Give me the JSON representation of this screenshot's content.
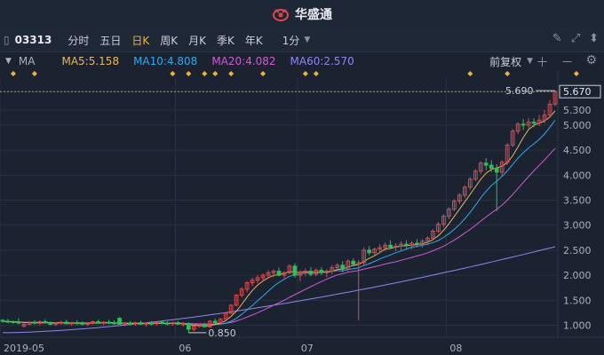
{
  "header": {
    "brand": "华盛通"
  },
  "toolbar": {
    "ticker": "03313",
    "periods": [
      "分时",
      "五日",
      "日K",
      "周K",
      "月K",
      "季K",
      "年K"
    ],
    "active_period": "日K",
    "minute_select": "1分"
  },
  "ma_bar": {
    "label": "MA",
    "ma5": "MA5:5.158",
    "ma10": "MA10:4.808",
    "ma20": "MA20:4.082",
    "ma60": "MA60:2.570",
    "fq": "前复权"
  },
  "colors": {
    "up": "#e0474c",
    "down": "#2fbf5a",
    "ma5": "#e8b65a",
    "ma10": "#34a6e8",
    "ma20": "#d35ad3",
    "ma60": "#8f86f0",
    "bg": "#1b2331",
    "grid": "#283243",
    "accent": "#f0b23a"
  },
  "chart_data": {
    "type": "candlestick",
    "ylim": [
      0.76,
      5.94
    ],
    "y_ticks": [
      "1.000",
      "1.500",
      "2.000",
      "2.500",
      "3.000",
      "3.500",
      "4.000",
      "4.500",
      "5.000",
      "5.300",
      "5.670"
    ],
    "x_ticks": [
      {
        "label": "2019-05",
        "index": 0
      },
      {
        "label": "06",
        "index": 33
      },
      {
        "label": "07",
        "index": 56
      },
      {
        "label": "08",
        "index": 84
      }
    ],
    "annotations": {
      "high_label": "5.690",
      "low_label": "0.850",
      "last_price": "5.670"
    },
    "event_markers": [
      2,
      6,
      32,
      35,
      38,
      40,
      43,
      49,
      57,
      59,
      88,
      95,
      108
    ],
    "candles": [
      [
        1.1,
        1.12,
        1.05,
        1.08
      ],
      [
        1.08,
        1.13,
        1.04,
        1.07
      ],
      [
        1.07,
        1.1,
        1.03,
        1.06
      ],
      [
        1.06,
        1.14,
        1.02,
        1.05
      ],
      [
        0.98,
        1.04,
        0.96,
        1.02
      ],
      [
        1.02,
        1.08,
        1.0,
        1.06
      ],
      [
        1.06,
        1.1,
        1.02,
        1.04
      ],
      [
        1.04,
        1.09,
        1.0,
        1.07
      ],
      [
        1.07,
        1.12,
        1.03,
        1.05
      ],
      [
        1.05,
        1.08,
        1.0,
        1.02
      ],
      [
        1.02,
        1.06,
        0.98,
        1.04
      ],
      [
        1.04,
        1.09,
        1.01,
        1.06
      ],
      [
        1.06,
        1.11,
        1.02,
        1.03
      ],
      [
        1.03,
        1.07,
        0.99,
        1.05
      ],
      [
        1.05,
        1.1,
        1.01,
        1.04
      ],
      [
        1.04,
        1.08,
        1.0,
        1.02
      ],
      [
        1.02,
        1.06,
        0.98,
        1.05
      ],
      [
        1.05,
        1.09,
        1.01,
        1.07
      ],
      [
        1.07,
        1.11,
        1.03,
        1.04
      ],
      [
        1.04,
        1.08,
        1.0,
        1.06
      ],
      [
        1.06,
        1.11,
        1.02,
        1.05
      ],
      [
        1.05,
        1.1,
        1.01,
        1.03
      ],
      [
        1.14,
        1.16,
        1.01,
        1.02
      ],
      [
        1.02,
        1.06,
        0.98,
        1.04
      ],
      [
        1.04,
        1.08,
        1.0,
        1.03
      ],
      [
        1.03,
        1.07,
        0.99,
        1.05
      ],
      [
        1.05,
        1.09,
        1.01,
        1.02
      ],
      [
        1.02,
        1.06,
        0.97,
        1.04
      ],
      [
        1.04,
        1.08,
        1.0,
        1.03
      ],
      [
        1.03,
        1.07,
        0.99,
        1.06
      ],
      [
        1.06,
        1.1,
        1.02,
        1.04
      ],
      [
        1.04,
        1.08,
        1.0,
        1.03
      ],
      [
        1.03,
        1.07,
        0.99,
        1.05
      ],
      [
        1.05,
        1.09,
        1.01,
        1.02
      ],
      [
        1.02,
        1.06,
        0.97,
        1.03
      ],
      [
        1.03,
        1.06,
        0.85,
        0.92
      ],
      [
        0.92,
        1.0,
        0.88,
        0.98
      ],
      [
        0.98,
        1.03,
        0.95,
        1.01
      ],
      [
        1.01,
        1.05,
        0.96,
        0.97
      ],
      [
        0.97,
        1.1,
        0.95,
        1.08
      ],
      [
        1.08,
        1.13,
        1.02,
        1.05
      ],
      [
        1.05,
        1.15,
        1.03,
        1.12
      ],
      [
        1.12,
        1.26,
        1.1,
        1.24
      ],
      [
        1.24,
        1.42,
        1.22,
        1.4
      ],
      [
        1.4,
        1.62,
        1.38,
        1.6
      ],
      [
        1.6,
        1.76,
        1.56,
        1.72
      ],
      [
        1.72,
        1.88,
        1.66,
        1.85
      ],
      [
        1.85,
        1.95,
        1.78,
        1.9
      ],
      [
        1.9,
        2.0,
        1.84,
        1.95
      ],
      [
        1.95,
        2.04,
        1.88,
        2.0
      ],
      [
        2.0,
        2.1,
        1.95,
        2.05
      ],
      [
        2.05,
        2.12,
        1.96,
        2.08
      ],
      [
        2.08,
        2.15,
        1.98,
        2.0
      ],
      [
        2.0,
        2.08,
        1.92,
        2.05
      ],
      [
        2.05,
        2.22,
        2.02,
        2.18
      ],
      [
        2.18,
        2.24,
        1.95,
        2.0
      ],
      [
        2.0,
        2.1,
        1.88,
        2.06
      ],
      [
        2.06,
        2.14,
        1.98,
        2.08
      ],
      [
        2.08,
        2.16,
        1.98,
        2.02
      ],
      [
        2.02,
        2.14,
        1.98,
        2.1
      ],
      [
        2.1,
        2.16,
        2.0,
        2.05
      ],
      [
        2.05,
        2.12,
        1.96,
        2.08
      ],
      [
        2.08,
        2.2,
        2.02,
        2.15
      ],
      [
        2.15,
        2.24,
        2.08,
        2.2
      ],
      [
        2.2,
        2.28,
        2.06,
        2.12
      ],
      [
        2.12,
        2.32,
        2.08,
        2.28
      ],
      [
        2.28,
        2.34,
        2.18,
        2.22
      ],
      [
        2.22,
        2.3,
        1.1,
        2.25
      ],
      [
        2.25,
        2.56,
        2.2,
        2.5
      ],
      [
        2.5,
        2.58,
        2.4,
        2.45
      ],
      [
        2.45,
        2.55,
        2.38,
        2.52
      ],
      [
        2.52,
        2.62,
        2.44,
        2.55
      ],
      [
        2.55,
        2.66,
        2.48,
        2.6
      ],
      [
        2.6,
        2.7,
        2.52,
        2.56
      ],
      [
        2.56,
        2.64,
        2.48,
        2.58
      ],
      [
        2.58,
        2.68,
        2.5,
        2.62
      ],
      [
        2.62,
        2.7,
        2.54,
        2.6
      ],
      [
        2.6,
        2.68,
        2.52,
        2.64
      ],
      [
        2.64,
        2.72,
        2.56,
        2.62
      ],
      [
        2.62,
        2.72,
        2.55,
        2.68
      ],
      [
        2.68,
        2.78,
        2.6,
        2.74
      ],
      [
        2.74,
        2.92,
        2.7,
        2.88
      ],
      [
        2.88,
        3.06,
        2.84,
        3.02
      ],
      [
        3.02,
        3.22,
        2.96,
        3.18
      ],
      [
        3.18,
        3.36,
        3.12,
        3.32
      ],
      [
        3.32,
        3.52,
        3.28,
        3.48
      ],
      [
        3.48,
        3.64,
        3.42,
        3.6
      ],
      [
        3.6,
        3.8,
        3.54,
        3.76
      ],
      [
        3.76,
        3.96,
        3.7,
        3.92
      ],
      [
        3.92,
        4.12,
        3.88,
        4.08
      ],
      [
        4.08,
        4.28,
        4.02,
        4.24
      ],
      [
        4.24,
        4.34,
        4.1,
        4.2
      ],
      [
        4.2,
        4.3,
        4.06,
        4.14
      ],
      [
        4.14,
        4.22,
        3.28,
        4.06
      ],
      [
        4.06,
        4.3,
        3.98,
        4.26
      ],
      [
        4.26,
        4.64,
        4.2,
        4.6
      ],
      [
        4.6,
        4.92,
        4.56,
        4.88
      ],
      [
        4.88,
        5.06,
        4.82,
        5.02
      ],
      [
        5.02,
        5.12,
        4.9,
        5.0
      ],
      [
        5.0,
        5.14,
        4.94,
        5.06
      ],
      [
        5.06,
        5.14,
        4.96,
        5.04
      ],
      [
        5.04,
        5.2,
        4.98,
        5.1
      ],
      [
        5.1,
        5.3,
        5.04,
        5.2
      ],
      [
        5.2,
        5.5,
        5.14,
        5.42
      ],
      [
        5.42,
        5.69,
        5.38,
        5.67
      ]
    ],
    "ma60_start": 0.85,
    "ma60_end": 2.57
  }
}
